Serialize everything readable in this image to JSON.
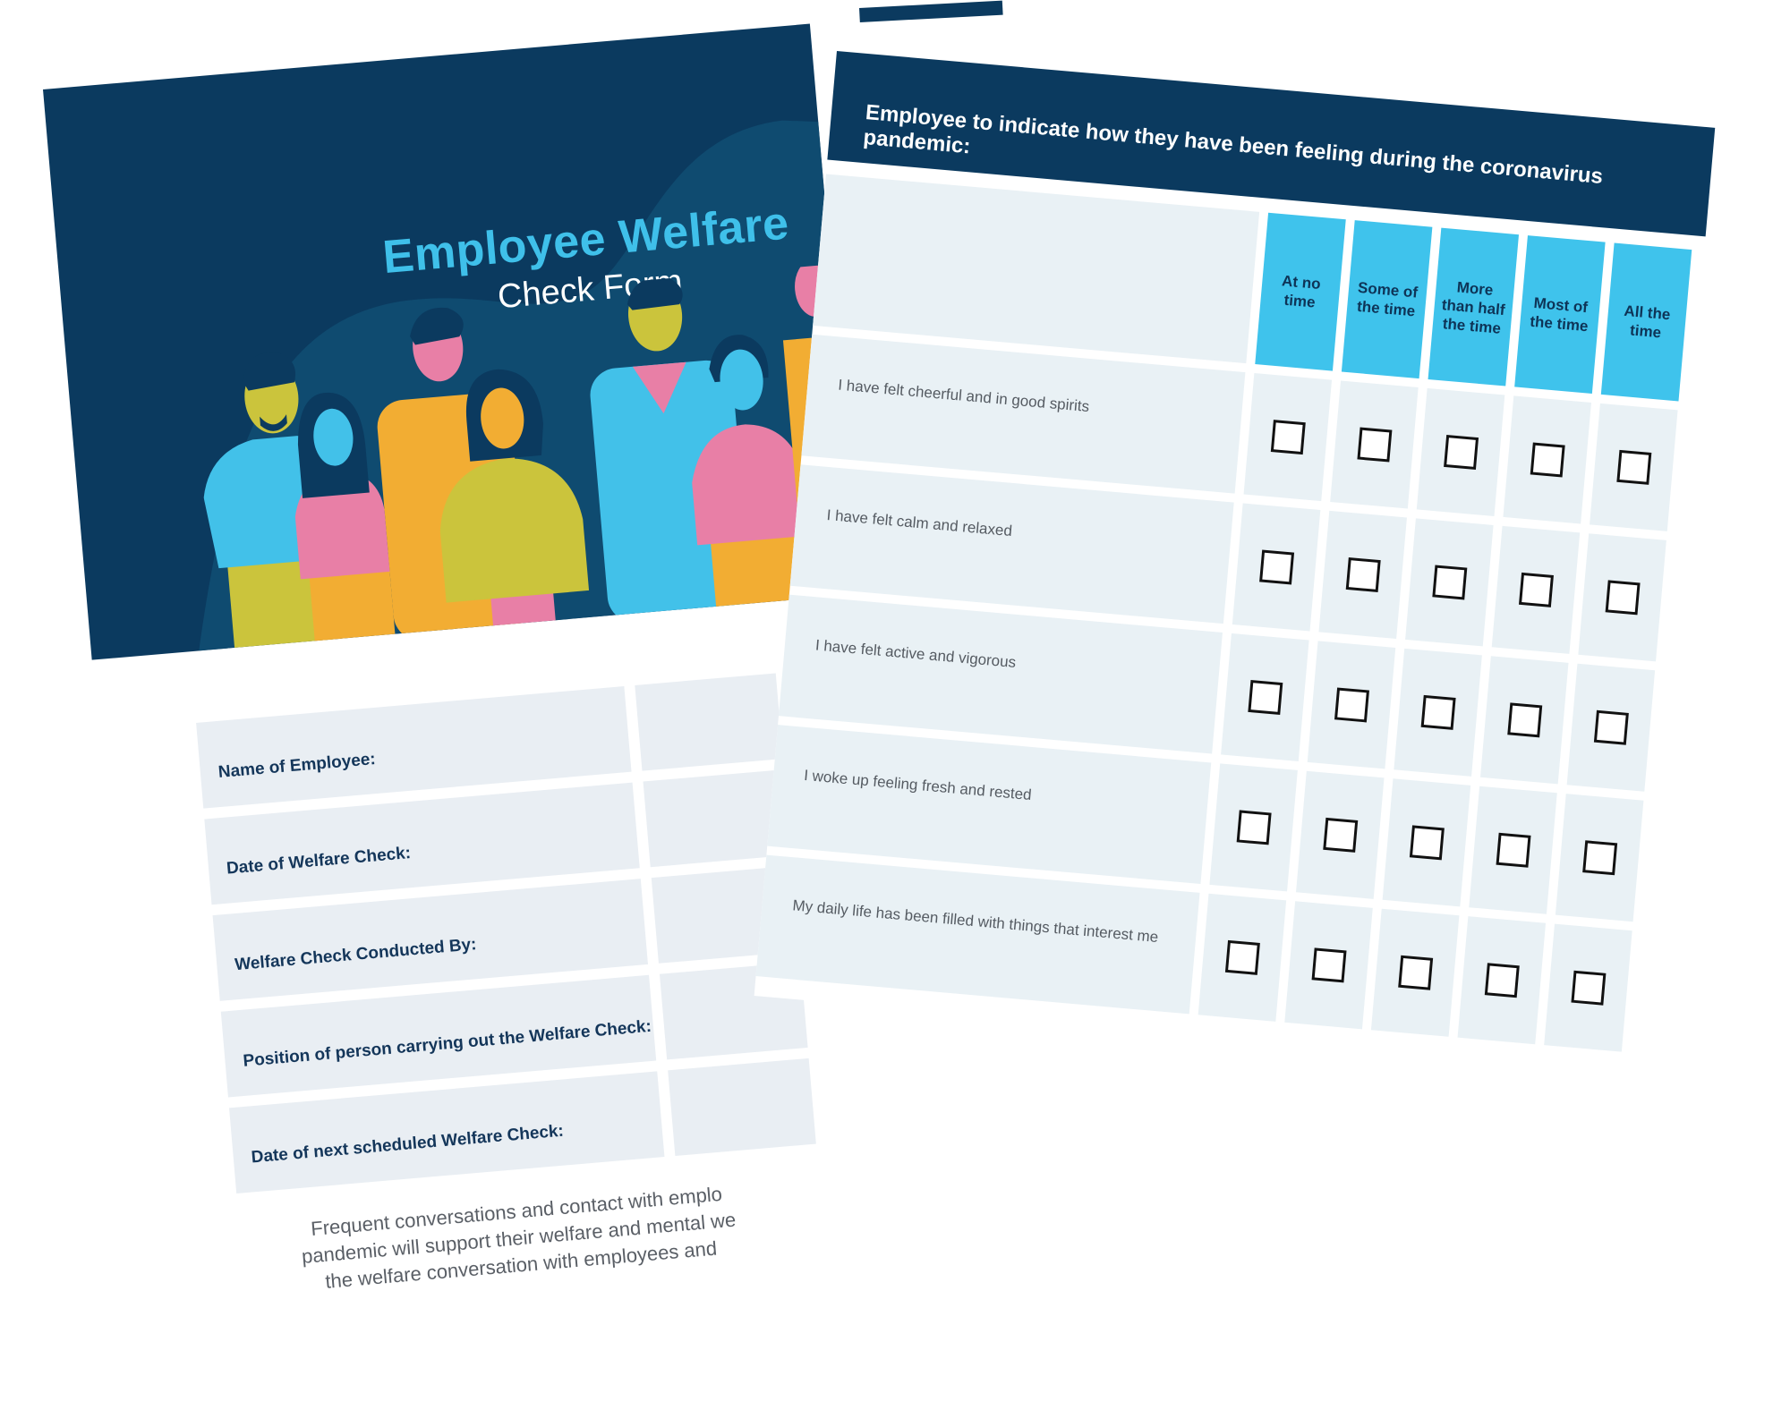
{
  "cover": {
    "title_line1": "Employee Welfare",
    "title_line2": "Check Form",
    "colors": {
      "background": "#0b3a5f",
      "wave": "#0f4b70",
      "title_accent": "#3fc0ea",
      "blue": "#42c1e9",
      "pink": "#e87fa6",
      "orange": "#f2ad33",
      "olive": "#cbc43c"
    }
  },
  "form": {
    "fields": [
      {
        "label": "Name of Employee:",
        "value": ""
      },
      {
        "label": "Date of Welfare Check:",
        "value": ""
      },
      {
        "label": "Welfare Check Conducted By:",
        "value": ""
      },
      {
        "label": "Position of person carrying out the Welfare Check:",
        "value": ""
      },
      {
        "label": "Date of next scheduled Welfare Check:",
        "value": ""
      }
    ],
    "note_lines": [
      "Frequent conversations and contact with emplo",
      "pandemic will support their welfare and mental we",
      "the welfare conversation with employees and"
    ]
  },
  "survey": {
    "header": "Employee to indicate how they have been feeling during the coronavirus pandemic:",
    "columns": [
      "At no time",
      "Some of the time",
      "More than half the time",
      "Most of the time",
      "All the time"
    ],
    "statements": [
      {
        "text": "I have felt cheerful and in good spirits",
        "checked": [
          false,
          false,
          false,
          false,
          false
        ]
      },
      {
        "text": "I have felt calm and relaxed",
        "checked": [
          false,
          false,
          false,
          false,
          false
        ]
      },
      {
        "text": "I have felt active and vigorous",
        "checked": [
          false,
          false,
          false,
          false,
          false
        ]
      },
      {
        "text": "I woke up feeling fresh and rested",
        "checked": [
          false,
          false,
          false,
          false,
          false
        ]
      },
      {
        "text": "My daily life has been filled with things that interest me",
        "checked": [
          false,
          false,
          false,
          false,
          false
        ]
      }
    ]
  }
}
